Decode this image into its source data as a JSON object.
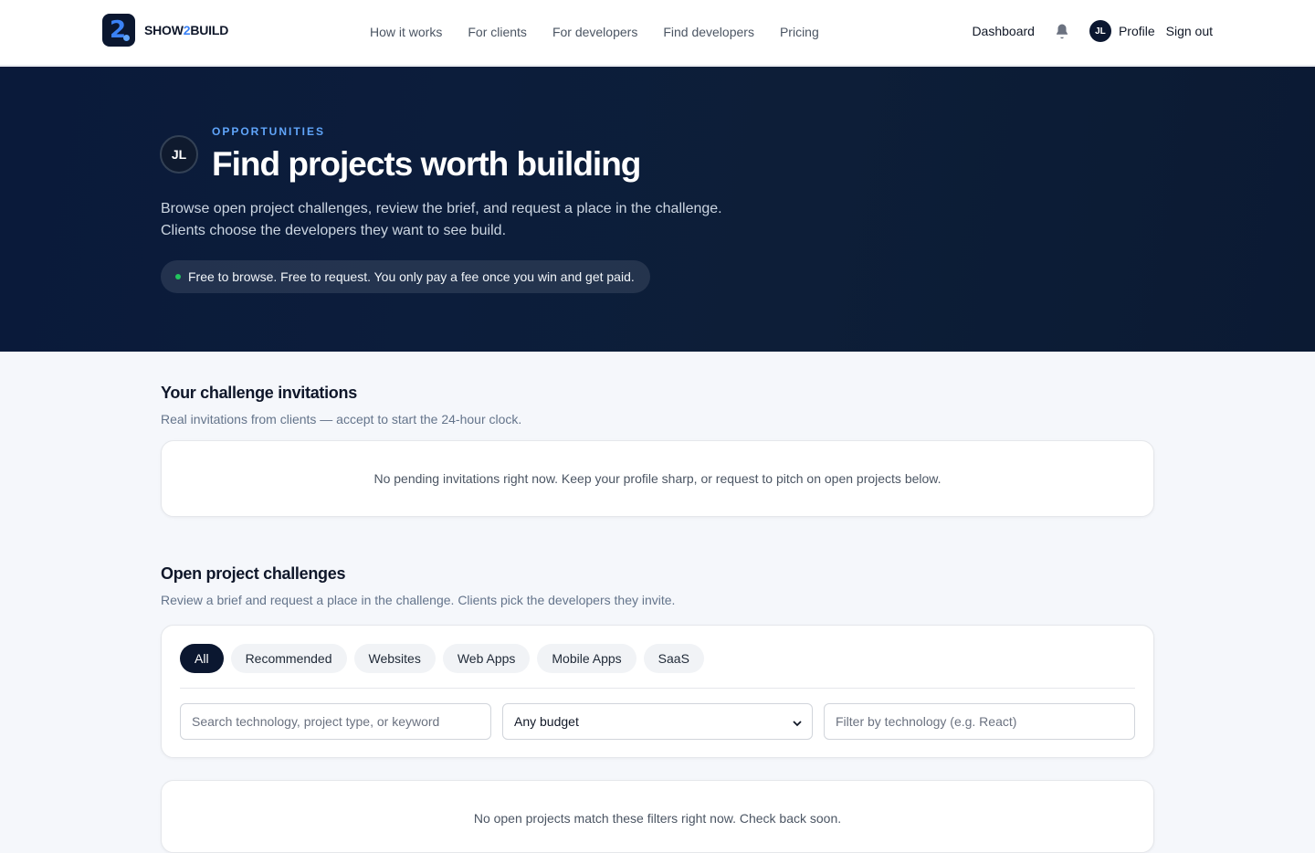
{
  "brand": {
    "name_prefix": "SHOW",
    "name_accent": "2",
    "name_suffix": "BUILD",
    "mark": "2"
  },
  "nav": {
    "items": [
      {
        "label": "How it works"
      },
      {
        "label": "For clients"
      },
      {
        "label": "For developers"
      },
      {
        "label": "Find developers"
      },
      {
        "label": "Pricing"
      }
    ]
  },
  "user": {
    "dashboard_label": "Dashboard",
    "initials": "JL",
    "profile_label": "Profile",
    "signout_label": "Sign out",
    "icons": {
      "notifications": "bell-icon"
    }
  },
  "hero": {
    "eyebrow": "OPPORTUNITIES",
    "title": "Find projects worth building",
    "description_line1": "Browse open project challenges, review the brief, and request a place in the challenge.",
    "description_line2": "Clients choose the developers they want to see build.",
    "pill": "Free to browse. Free to request. You only pay a fee once you win and get paid.",
    "avatar_initials": "JL"
  },
  "invitations": {
    "title": "Your challenge invitations",
    "subtitle": "Real invitations from clients — accept to start the 24-hour clock.",
    "empty": "No pending invitations right now. Keep your profile sharp, or request to pitch on open projects below."
  },
  "open_projects": {
    "title": "Open project challenges",
    "subtitle": "Review a brief and request a place in the challenge. Clients pick the developers they invite.",
    "filters": [
      {
        "label": "All",
        "active": true
      },
      {
        "label": "Recommended",
        "active": false
      },
      {
        "label": "Websites",
        "active": false
      },
      {
        "label": "Web Apps",
        "active": false
      },
      {
        "label": "Mobile Apps",
        "active": false
      },
      {
        "label": "SaaS",
        "active": false
      }
    ],
    "search_placeholder": "Search technology, project type, or keyword",
    "budget_selected": "Any budget",
    "tech_placeholder": "Filter by technology (e.g. React)",
    "empty": "No open projects match these filters right now. Check back soon."
  },
  "colors": {
    "navy": "#0b1730",
    "accent_blue": "#3b82f6",
    "eyebrow_blue": "#60a5fa",
    "status_green": "#22c55e",
    "page_bg": "#f5f7fb"
  }
}
